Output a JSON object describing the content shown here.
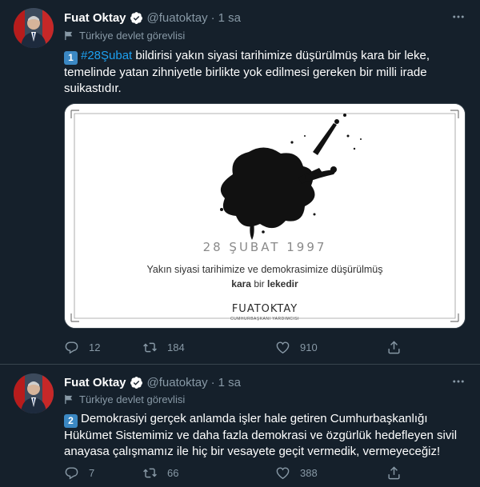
{
  "tweets": [
    {
      "name": "Fuat Oktay",
      "handle": "@fuatoktay",
      "dot": "·",
      "time": "1 sa",
      "label": "Türkiye devlet görevlisi",
      "keycap": "1",
      "hashtag": "#28Şubat",
      "text": " bildirisi yakın siyasi tarihimize düşürülmüş kara bir leke, temelinde yatan zihniyetle birlikte yok edilmesi gereken bir milli irade suikastıdır.",
      "media": {
        "title": "28 ŞUBAT 1997",
        "line1": "Yakın siyasi tarihimize ve demokrasimize düşürülmüş",
        "line2_bold1": "kara",
        "line2_mid": " bir ",
        "line2_bold2": "lekedir",
        "logo": "FUATOKTAY",
        "logo_sub": "CUMHURBAŞKANI YARDIMCISI"
      },
      "replies": "12",
      "retweets": "184",
      "likes": "910"
    },
    {
      "name": "Fuat Oktay",
      "handle": "@fuatoktay",
      "dot": "·",
      "time": "1 sa",
      "label": "Türkiye devlet görevlisi",
      "keycap": "2",
      "text": "Demokrasiyi gerçek anlamda işler hale getiren Cumhurbaşkanlığı Hükümet Sistemimiz ve daha fazla demokrasi ve özgürlük hedefleyen sivil anayasa çalışmamız ile hiç bir vesayete geçit vermedik, vermeyeceğiz!",
      "replies": "7",
      "retweets": "66",
      "likes": "388"
    }
  ],
  "colors": {
    "background": "#15202b",
    "secondary_text": "#8899a6",
    "link": "#1da1f2",
    "divider": "#38444d",
    "keycap": "#3b88c3"
  }
}
